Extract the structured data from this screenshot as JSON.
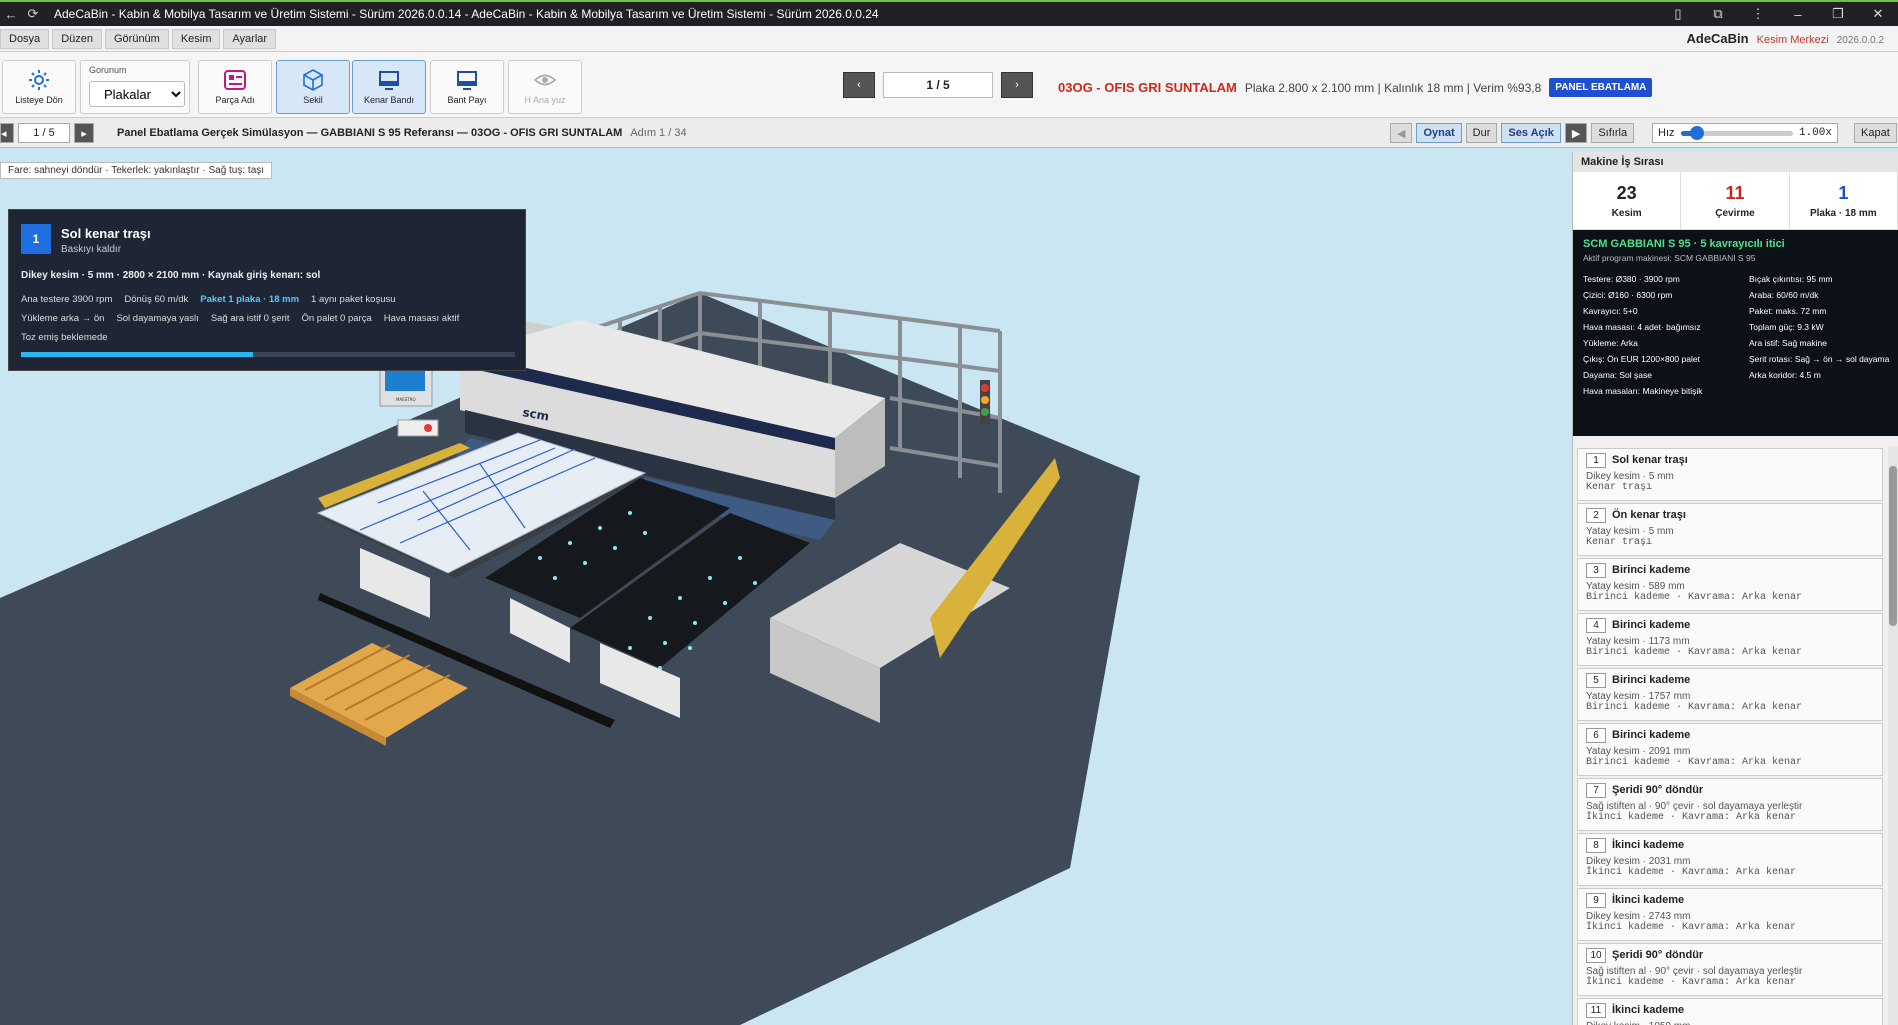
{
  "window": {
    "title": "AdeCaBin - Kabin & Mobilya Tasarım ve Üretim Sistemi - Sürüm 2026.0.0.14 - AdeCaBin - Kabin & Mobilya Tasarım ve Üretim Sistemi - Sürüm 2026.0.0.24"
  },
  "menu": {
    "items": [
      "Dosya",
      "Düzen",
      "Görünüm",
      "Kesim",
      "Ayarlar"
    ],
    "brand": "AdeCaBin",
    "module": "Kesim Merkezi",
    "version": "2026.0.0.2"
  },
  "toolbar": {
    "back_label": "Listeye Dön",
    "view_label": "Gorunum",
    "view_value": "Plakalar",
    "part_name_label": "Parça Adı",
    "shape_label": "Sekil",
    "edge_band_label": "Kenar Bandı",
    "band_share_label": "Bant Payı",
    "main_face_label": "H Ana yuz",
    "plate_page": "1 / 5",
    "material_name": "03OG - OFIS GRI SUNTALAM",
    "material_details": "Plaka 2.800 x 2.100 mm | Kalınlık 18 mm | Verim %93,8",
    "mode_badge": "PANEL EBATLAMA"
  },
  "simbar": {
    "page": "1 / 5",
    "title": "Panel Ebatlama Gerçek Simülasyon — GABBIANI S 95 Referansı — 03OG - OFIS GRI SUNTALAM",
    "step": "Adım 1 / 34",
    "play_label": "Oynat",
    "stop_label": "Dur",
    "sound_label": "Ses Açık",
    "reset_label": "Sıfırla",
    "speed_label": "Hız",
    "speed_value": "1.00x",
    "speed_level": 0.15,
    "close_label": "Kapat"
  },
  "scene": {
    "hint": "Fare: sahneyi döndür · Tekerlek: yakınlaştır · Sağ tuş: taşı",
    "machine_brand": "scm",
    "console_brand": "MAESTRO"
  },
  "step_card": {
    "number": "1",
    "title": "Sol kenar traşı",
    "subtitle": "Baskıyı kaldır",
    "detail": "Dikey kesim · 5 mm · 2800 × 2100 mm · Kaynak giriş kenarı: sol",
    "row1": [
      "Ana testere 3900 rpm",
      "Dönüş 60 m/dk",
      "Paket 1 plaka · 18 mm",
      "1 aynı paket koşusu"
    ],
    "row2": [
      "Yükleme arka → ön",
      "Sol dayamaya yaslı",
      "Sağ ara istif 0 şerit",
      "Ön palet 0 parça",
      "Hava masası aktif"
    ],
    "row3": "Toz emiş beklemede",
    "progress": 0.47
  },
  "panel": {
    "title": "Makine İş Sırası",
    "stats": [
      {
        "value": "23",
        "label": "Kesim",
        "color": "#222222"
      },
      {
        "value": "11",
        "label": "Çevirme",
        "color": "#d0281f"
      },
      {
        "value": "1",
        "label": "Plaka · 18 mm",
        "color": "#1f4fd1"
      }
    ],
    "machine_title": "SCM GABBIANI S 95 · 5 kavrayıcılı itici",
    "machine_sub": "Aktif program makinesi: SCM GABBIANI S 95",
    "specs": [
      "Testere: Ø380 · 3900 rpm",
      "Bıçak çıkıntısı: 95 mm",
      "Çizici: Ø160 · 6300 rpm",
      "Araba: 60/60 m/dk",
      "Kavrayıcı: 5+0",
      "Paket: maks. 72 mm",
      "Hava masası: 4 adet· bağımsız",
      "Toplam güç: 9.3 kW",
      "Yükleme: Arka",
      "Ara istif: Sağ makine",
      "Çıkış: Ön EUR 1200×800 palet",
      "Şerit rotası: Sağ → ön → sol dayama",
      "Dayama: Sol şase",
      "Arka koridor: 4.5 m",
      "Hava masaları: Makineye bitişik",
      ""
    ],
    "jobs": [
      {
        "n": "1",
        "title": "Sol kenar traşı",
        "l1": "Dikey kesim · 5 mm",
        "l2": "Kenar traşı"
      },
      {
        "n": "2",
        "title": "Ön kenar traşı",
        "l1": "Yatay kesim · 5 mm",
        "l2": "Kenar traşı"
      },
      {
        "n": "3",
        "title": "Birinci kademe",
        "l1": "Yatay kesim · 589 mm",
        "l2": "Birinci kademe · Kavrama: Arka kenar"
      },
      {
        "n": "4",
        "title": "Birinci kademe",
        "l1": "Yatay kesim · 1173 mm",
        "l2": "Birinci kademe · Kavrama: Arka kenar"
      },
      {
        "n": "5",
        "title": "Birinci kademe",
        "l1": "Yatay kesim · 1757 mm",
        "l2": "Birinci kademe · Kavrama: Arka kenar"
      },
      {
        "n": "6",
        "title": "Birinci kademe",
        "l1": "Yatay kesim · 2091 mm",
        "l2": "Birinci kademe · Kavrama: Arka kenar"
      },
      {
        "n": "7",
        "title": "Şeridi 90° döndür",
        "l1": "Sağ istiften al · 90° çevir · sol dayamaya yerleştir",
        "l2": "İkinci kademe · Kavrama: Arka kenar"
      },
      {
        "n": "8",
        "title": "İkinci kademe",
        "l1": "Dikey kesim · 2031 mm",
        "l2": "İkinci kademe · Kavrama: Arka kenar"
      },
      {
        "n": "9",
        "title": "İkinci kademe",
        "l1": "Dikey kesim · 2743 mm",
        "l2": "İkinci kademe · Kavrama: Arka kenar"
      },
      {
        "n": "10",
        "title": "Şeridi 90° döndür",
        "l1": "Sağ istiften al · 90° çevir · sol dayamaya yerleştir",
        "l2": "İkinci kademe · Kavrama: Arka kenar"
      },
      {
        "n": "11",
        "title": "İkinci kademe",
        "l1": "Dikey kesim · 1059 mm",
        "l2": ""
      }
    ]
  }
}
